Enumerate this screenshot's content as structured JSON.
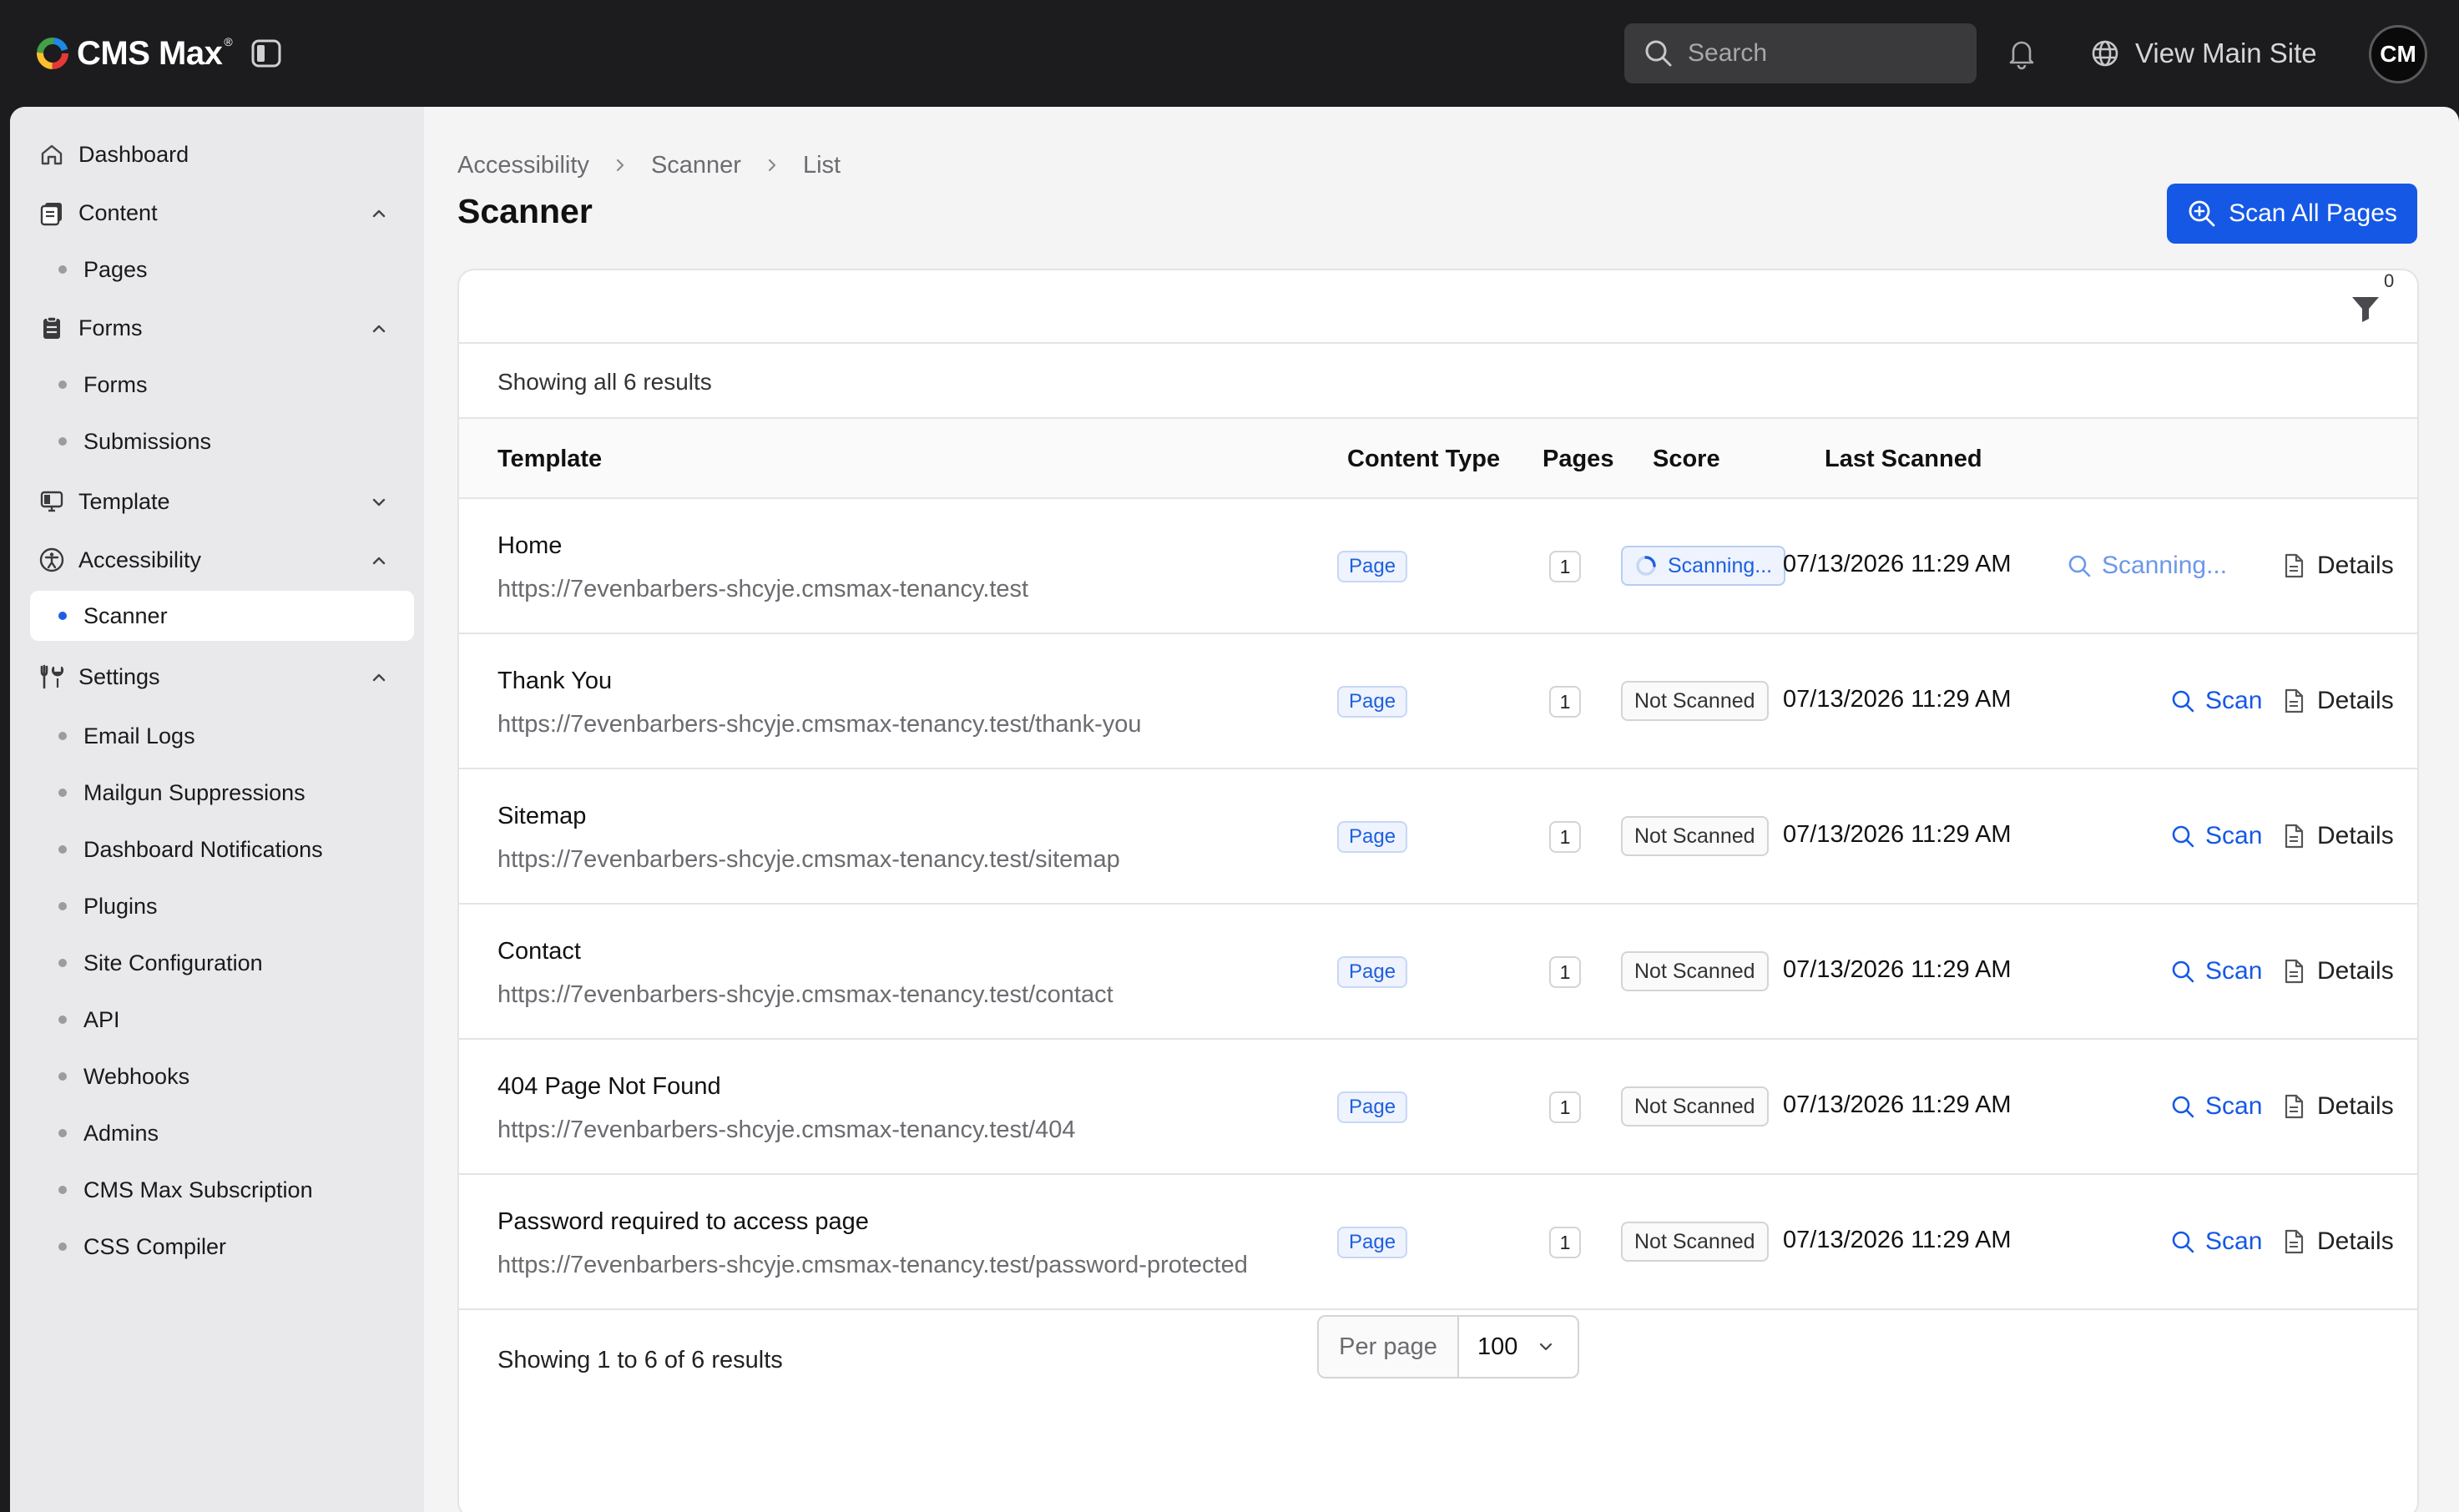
{
  "app": {
    "logo_text": "CMS Max",
    "logo_reg": "®"
  },
  "topbar": {
    "search_placeholder": "Search",
    "view_site_label": "View Main Site",
    "avatar_initials": "CM"
  },
  "sidebar": {
    "dashboard": "Dashboard",
    "content": "Content",
    "pages": "Pages",
    "forms_group": "Forms",
    "forms": "Forms",
    "submissions": "Submissions",
    "template": "Template",
    "accessibility": "Accessibility",
    "scanner": "Scanner",
    "settings": "Settings",
    "settings_items": [
      "Email Logs",
      "Mailgun Suppressions",
      "Dashboard Notifications",
      "Plugins",
      "Site Configuration",
      "API",
      "Webhooks",
      "Admins",
      "CMS Max Subscription",
      "CSS Compiler"
    ]
  },
  "breadcrumb": [
    "Accessibility",
    "Scanner",
    "List"
  ],
  "page_title": "Scanner",
  "scan_all_label": "Scan All Pages",
  "filter_count": "0",
  "showing_top": "Showing all 6 results",
  "columns": {
    "template": "Template",
    "content_type": "Content Type",
    "pages": "Pages",
    "score": "Score",
    "last_scanned": "Last Scanned"
  },
  "rows": [
    {
      "title": "Home",
      "url": "https://7evenbarbers-shcyje.cmsmax-tenancy.test",
      "content_type": "Page",
      "pages": "1",
      "score": "Scanning...",
      "last_scanned": "07/13/2026 11:29 AM",
      "action": "Scanning...",
      "details": "Details"
    },
    {
      "title": "Thank You",
      "url": "https://7evenbarbers-shcyje.cmsmax-tenancy.test/thank-you",
      "content_type": "Page",
      "pages": "1",
      "score": "Not Scanned",
      "last_scanned": "07/13/2026 11:29 AM",
      "action": "Scan",
      "details": "Details"
    },
    {
      "title": "Sitemap",
      "url": "https://7evenbarbers-shcyje.cmsmax-tenancy.test/sitemap",
      "content_type": "Page",
      "pages": "1",
      "score": "Not Scanned",
      "last_scanned": "07/13/2026 11:29 AM",
      "action": "Scan",
      "details": "Details"
    },
    {
      "title": "Contact",
      "url": "https://7evenbarbers-shcyje.cmsmax-tenancy.test/contact",
      "content_type": "Page",
      "pages": "1",
      "score": "Not Scanned",
      "last_scanned": "07/13/2026 11:29 AM",
      "action": "Scan",
      "details": "Details"
    },
    {
      "title": "404 Page Not Found",
      "url": "https://7evenbarbers-shcyje.cmsmax-tenancy.test/404",
      "content_type": "Page",
      "pages": "1",
      "score": "Not Scanned",
      "last_scanned": "07/13/2026 11:29 AM",
      "action": "Scan",
      "details": "Details"
    },
    {
      "title": "Password required to access page",
      "url": "https://7evenbarbers-shcyje.cmsmax-tenancy.test/password-protected",
      "content_type": "Page",
      "pages": "1",
      "score": "Not Scanned",
      "last_scanned": "07/13/2026 11:29 AM",
      "action": "Scan",
      "details": "Details"
    }
  ],
  "pagination": {
    "showing": "Showing 1 to 6 of 6 results",
    "per_page_label": "Per page",
    "per_page_value": "100"
  },
  "colors": {
    "accent": "#1558e6",
    "topbar": "#1c1c1e",
    "sidebar": "#e9e9eb"
  },
  "icons": [
    "logo-ring-icon",
    "sidebar-toggle-icon",
    "search-icon",
    "bell-icon",
    "globe-icon",
    "home-icon",
    "content-icon",
    "forms-icon",
    "template-icon",
    "accessibility-icon",
    "settings-icon",
    "chevron-up-icon",
    "chevron-down-icon",
    "chevron-right-icon",
    "zoom-plus-icon",
    "filter-icon",
    "spinner-icon",
    "document-icon"
  ]
}
